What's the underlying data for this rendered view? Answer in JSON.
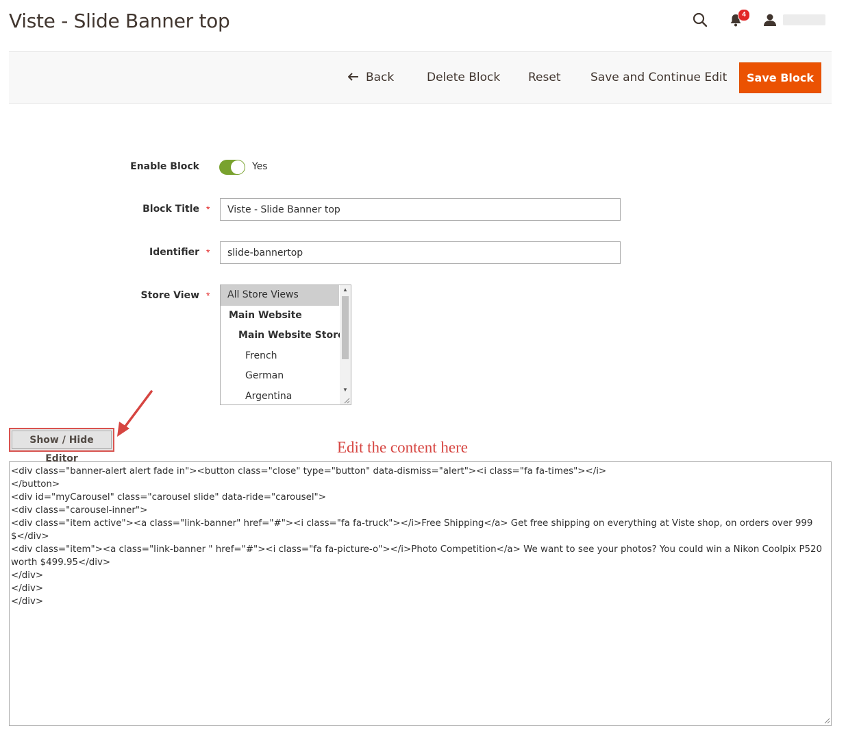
{
  "page": {
    "title": "Viste - Slide Banner top"
  },
  "header": {
    "notification_count": "4"
  },
  "actions": {
    "back_label": "Back",
    "delete_label": "Delete Block",
    "reset_label": "Reset",
    "save_continue_label": "Save and Continue Edit",
    "save_label": "Save Block"
  },
  "form": {
    "enable_label": "Enable Block",
    "enable_value": "Yes",
    "title_label": "Block Title",
    "title_value": "Viste - Slide Banner top",
    "identifier_label": "Identifier",
    "identifier_value": "slide-bannertop",
    "store_view_label": "Store View",
    "store_views": [
      "All Store Views",
      "Main Website",
      "Main Website Store",
      "French",
      "German",
      "Argentina"
    ],
    "required_mark": "*"
  },
  "editor": {
    "toggle_label": "Show / Hide Editor",
    "annotation": "Edit the content here",
    "content": "<div class=\"banner-alert alert fade in\"><button class=\"close\" type=\"button\" data-dismiss=\"alert\"><i class=\"fa fa-times\"></i>\n</button>\n<div id=\"myCarousel\" class=\"carousel slide\" data-ride=\"carousel\">\n<div class=\"carousel-inner\">\n<div class=\"item active\"><a class=\"link-banner\" href=\"#\"><i class=\"fa fa-truck\"></i>Free Shipping</a> Get free shipping on everything at Viste shop, on orders over 999 $</div>\n<div class=\"item\"><a class=\"link-banner \" href=\"#\"><i class=\"fa fa-picture-o\"></i>Photo Competition</a> We want to see your photos? You could win a Nikon Coolpix P520 worth $499.95</div>\n</div>\n</div>\n</div>"
  },
  "colors": {
    "primary_button": "#eb5202",
    "toggle_on": "#79a22e",
    "annotation": "#d64541",
    "badge": "#e22626"
  }
}
